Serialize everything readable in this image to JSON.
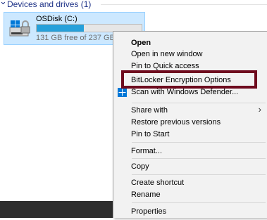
{
  "section": {
    "title": "Devices and drives (1)"
  },
  "drive": {
    "name": "OSDisk (C:)",
    "space_text": "131 GB free of 237 GB",
    "used_fraction": 0.447
  },
  "menu": {
    "items": [
      {
        "label": "Open"
      },
      {
        "label": "Open in new window"
      },
      {
        "label": "Pin to Quick access"
      },
      {
        "label": "BitLocker Encryption Options"
      },
      {
        "label": "Scan with Windows Defender..."
      },
      {
        "label": "Share with"
      },
      {
        "label": "Restore previous versions"
      },
      {
        "label": "Pin to Start"
      },
      {
        "label": "Format..."
      },
      {
        "label": "Copy"
      },
      {
        "label": "Create shortcut"
      },
      {
        "label": "Rename"
      },
      {
        "label": "Properties"
      }
    ]
  },
  "colors": {
    "highlight_border": "#6e0a1e",
    "selection_fill": "#cce8ff",
    "progress_fill": "#26a0da",
    "header_text": "#1e3287"
  }
}
